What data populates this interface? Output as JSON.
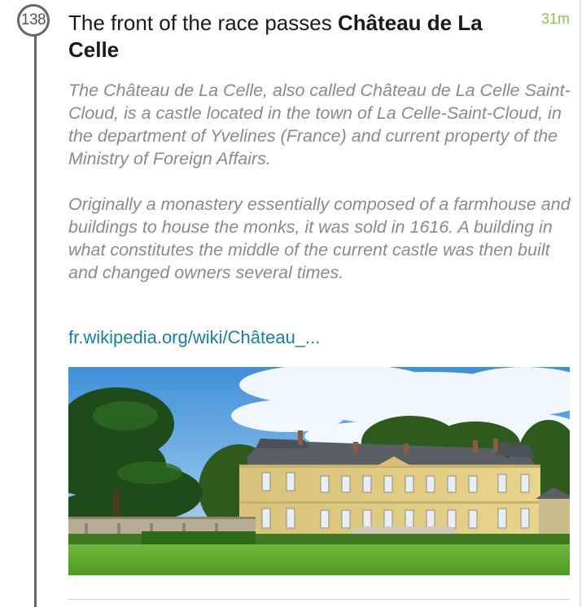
{
  "entry": {
    "number": "138",
    "time": "31m",
    "title_prefix": "The front of the race passes ",
    "title_place": "Château de La Celle",
    "paragraphs": [
      "The Château de La Celle, also called Château de La Celle Saint-Cloud, is a castle located in the town of La Celle-Saint-Cloud, in the department of Yvelines (France) and current property of the Ministry of Foreign Affairs.",
      "Originally a monastery essentially composed of a farmhouse and buildings to house the monks, it was sold in 1616. A building in what constitutes the middle of the current castle was then built and changed owners several times."
    ],
    "link_text": "fr.wikipedia.org/wiki/Château_..."
  },
  "colors": {
    "accent_time": "#8bc34a",
    "link": "#1a7fa3",
    "timeline": "#666666"
  },
  "icons": {
    "photo": "chateau-photo"
  }
}
